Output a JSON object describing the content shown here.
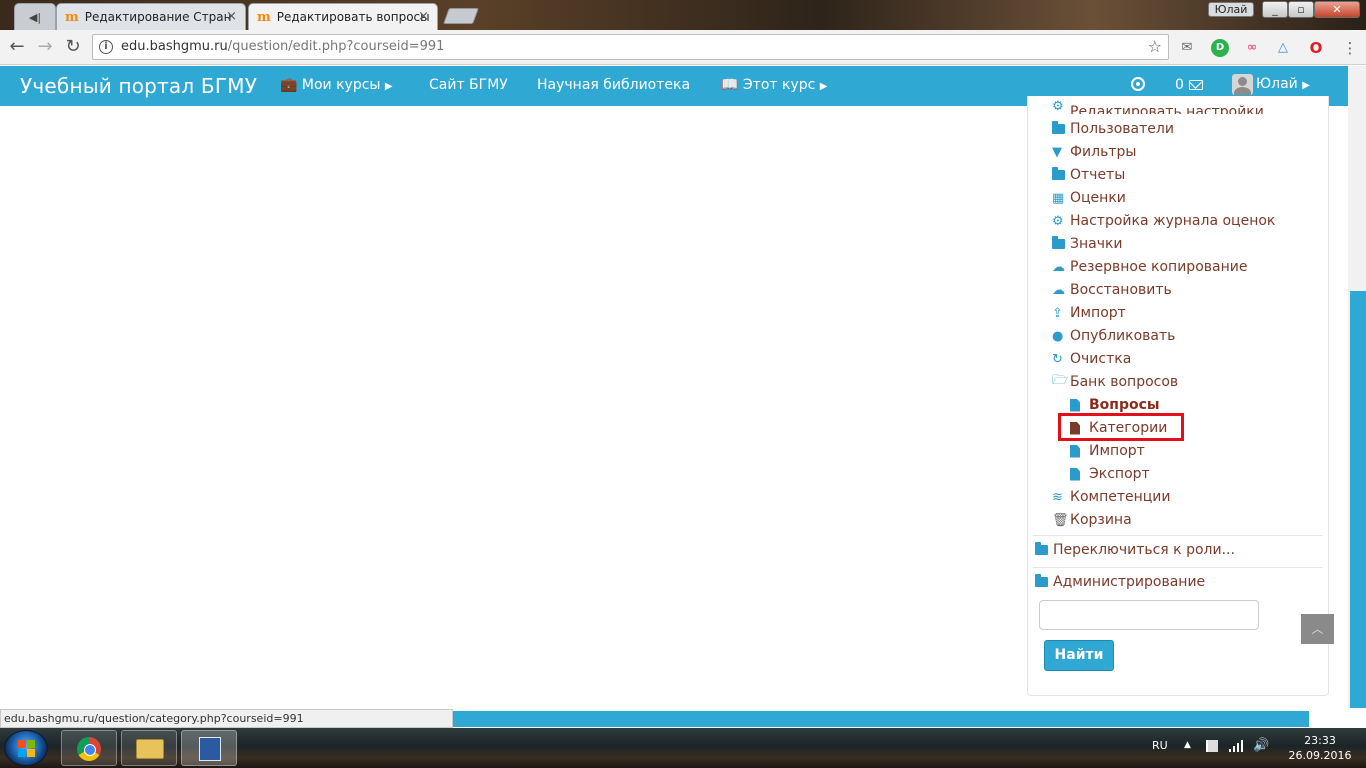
{
  "browser": {
    "tabs": [
      {
        "title": "Редактирование Стран"
      },
      {
        "title": "Редактировать вопросы"
      }
    ],
    "user_chip": "Юлай",
    "url_host": "edu.bashgmu.ru",
    "url_path": "/question/edit.php?courseid=991",
    "status_url": "edu.bashgmu.ru/question/category.php?courseid=991"
  },
  "navbar": {
    "brand": "Учебный портал БГМУ",
    "my_courses": "Мои курсы",
    "site": "Сайт БГМУ",
    "library": "Научная библиотека",
    "this_course": "Этот курс",
    "messages_count": "0",
    "user_name": "Юлай"
  },
  "admin_menu": {
    "cut_item": "Редактировать настройки",
    "items": [
      {
        "label": "Пользователи",
        "icon": "folder-icon"
      },
      {
        "label": "Фильтры",
        "icon": "filter-icon"
      },
      {
        "label": "Отчеты",
        "icon": "folder-icon"
      },
      {
        "label": "Оценки",
        "icon": "table-icon"
      },
      {
        "label": "Настройка журнала оценок",
        "icon": "cogs-icon"
      },
      {
        "label": "Значки",
        "icon": "folder-icon"
      },
      {
        "label": "Резервное копирование",
        "icon": "cloud-download-icon"
      },
      {
        "label": "Восстановить",
        "icon": "cloud-upload-icon"
      },
      {
        "label": "Импорт",
        "icon": "upload-icon"
      },
      {
        "label": "Опубликовать",
        "icon": "globe-icon"
      },
      {
        "label": "Очистка",
        "icon": "refresh-icon"
      },
      {
        "label": "Банк вопросов",
        "icon": "folder-open-icon"
      }
    ],
    "question_bank": [
      {
        "label": "Вопросы"
      },
      {
        "label": "Категории"
      },
      {
        "label": "Импорт"
      },
      {
        "label": "Экспорт"
      }
    ],
    "after_items": [
      {
        "label": "Компетенции",
        "icon": "competency-icon"
      },
      {
        "label": "Корзина",
        "icon": "trash-icon"
      }
    ],
    "switch_role": "Переключиться к роли...",
    "administration": "Администрирование",
    "search_button": "Найти"
  },
  "taskbar": {
    "lang": "RU",
    "time": "23:33",
    "date": "26.09.2016"
  },
  "colors": {
    "accent": "#2fa9d4",
    "link": "#7b3b2a",
    "highlight": "#e2101a"
  }
}
